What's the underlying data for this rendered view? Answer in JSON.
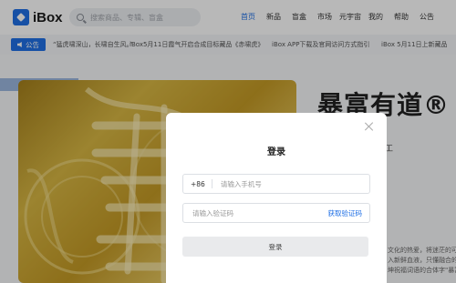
{
  "app": {
    "logo_text": "iBox"
  },
  "search": {
    "placeholder": "搜索商品、专辑、盲盒"
  },
  "nav": {
    "items": [
      "首页",
      "新品",
      "盲盒",
      "市场",
      "元宇宙",
      "我的",
      "帮助",
      "公告"
    ],
    "active": "首页"
  },
  "notice": {
    "tag": "公告",
    "items": [
      "“猛虎啸深山，长啸自生风。”",
      "iBox5月11日霞气开启合成目标藏品《赤啸虎》",
      "iBox APP下载及官网访问方式指引",
      "iBox 5月11日上新藏品"
    ]
  },
  "hero": {
    "title": "暴富有道®",
    "subtitle": "工",
    "desc_lines": [
      "文化的热爱，将迷茫的可",
      "入新鲜血液，只懂融合的",
      "坤祝福词语的合体字\"暴富有"
    ]
  },
  "modal": {
    "title": "登录",
    "country_code": "+86",
    "phone_placeholder": "请输入手机号",
    "code_placeholder": "请输入验证码",
    "get_code_label": "获取验证码",
    "login_label": "登录"
  },
  "colors": {
    "accent": "#1f6fe5",
    "gold": "#d8b743"
  }
}
